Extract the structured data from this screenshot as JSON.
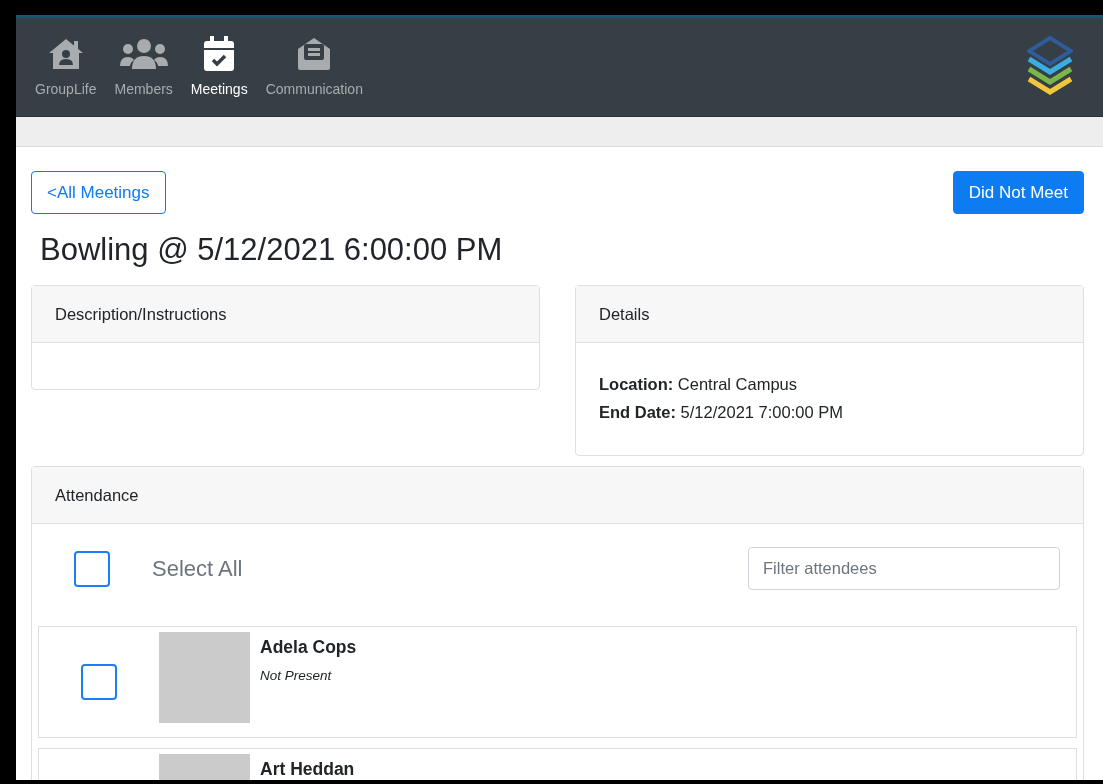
{
  "nav": {
    "items": [
      {
        "label": "GroupLife",
        "selected": false
      },
      {
        "label": "Members",
        "selected": false
      },
      {
        "label": "Meetings",
        "selected": true
      },
      {
        "label": "Communication",
        "selected": false
      }
    ]
  },
  "back_button": "<All Meetings",
  "did_not_meet_button": "Did Not Meet",
  "title": "Bowling @ 5/12/2021 6:00:00 PM",
  "description_card": {
    "header": "Description/Instructions"
  },
  "details_card": {
    "header": "Details",
    "fields": [
      {
        "label": "Location:",
        "value": "Central Campus"
      },
      {
        "label": "End Date:",
        "value": "5/12/2021 7:00:00 PM"
      }
    ]
  },
  "attendance": {
    "header": "Attendance",
    "select_all": {
      "label": "Select All",
      "checked": false
    },
    "filter": {
      "placeholder": "Filter attendees"
    },
    "attendees": [
      {
        "name": "Adela Cops",
        "status": "Not Present",
        "checked": false
      },
      {
        "name": "Art Heddan"
      }
    ]
  }
}
